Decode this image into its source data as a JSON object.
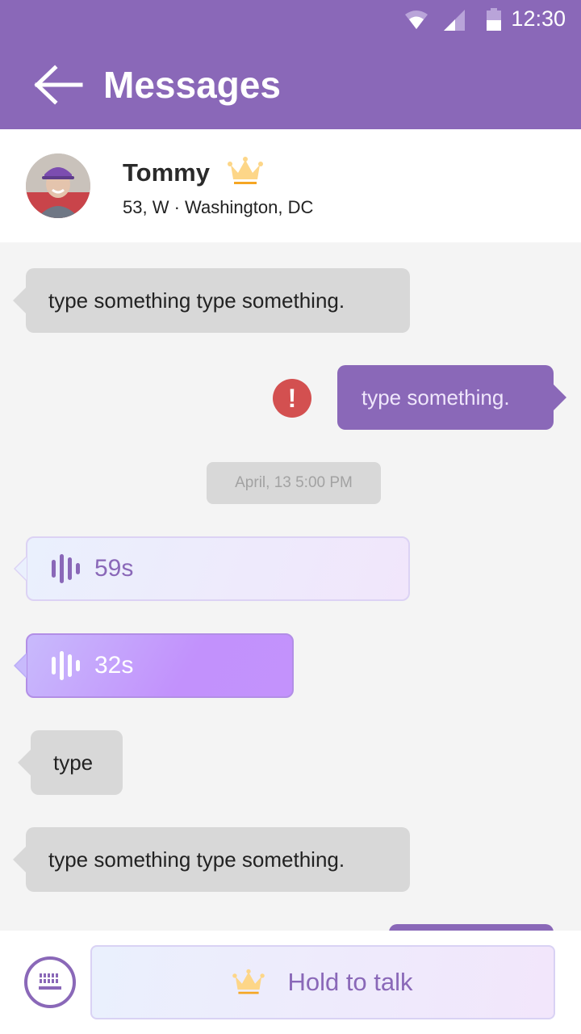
{
  "status_bar": {
    "time": "12:30",
    "icons": [
      "wifi-icon",
      "cellular-signal-icon",
      "battery-icon"
    ]
  },
  "header": {
    "back_icon": "arrow-left-icon",
    "title": "Messages",
    "background_color": "#8a68b8"
  },
  "contact": {
    "name": "Tommy",
    "badge_icon": "crown-icon",
    "details": "53, W · Washington, DC"
  },
  "messages": [
    {
      "direction": "incoming",
      "type": "text",
      "text": "type something type something."
    },
    {
      "direction": "outgoing",
      "type": "text",
      "text": "type something.",
      "status": "failed",
      "status_icon": "error-exclamation-icon"
    },
    {
      "type": "timestamp",
      "text": "April, 13 5:00 PM"
    },
    {
      "direction": "incoming",
      "type": "voice",
      "duration": "59s",
      "icon": "audio-wave-icon"
    },
    {
      "direction": "incoming",
      "type": "voice",
      "duration": "32s",
      "icon": "audio-wave-icon"
    },
    {
      "direction": "incoming",
      "type": "text",
      "text": "type"
    },
    {
      "direction": "incoming",
      "type": "text",
      "text": "type something type something."
    }
  ],
  "composer": {
    "keyboard_icon": "keyboard-icon",
    "hold_to_talk_label": "Hold to talk",
    "hold_icon": "crown-icon"
  },
  "colors": {
    "accent": "#8a68b8",
    "incoming_bubble": "#d8d8d8",
    "error": "#d35050",
    "crown": "#fdd688",
    "crown_bar": "#f5a623"
  }
}
